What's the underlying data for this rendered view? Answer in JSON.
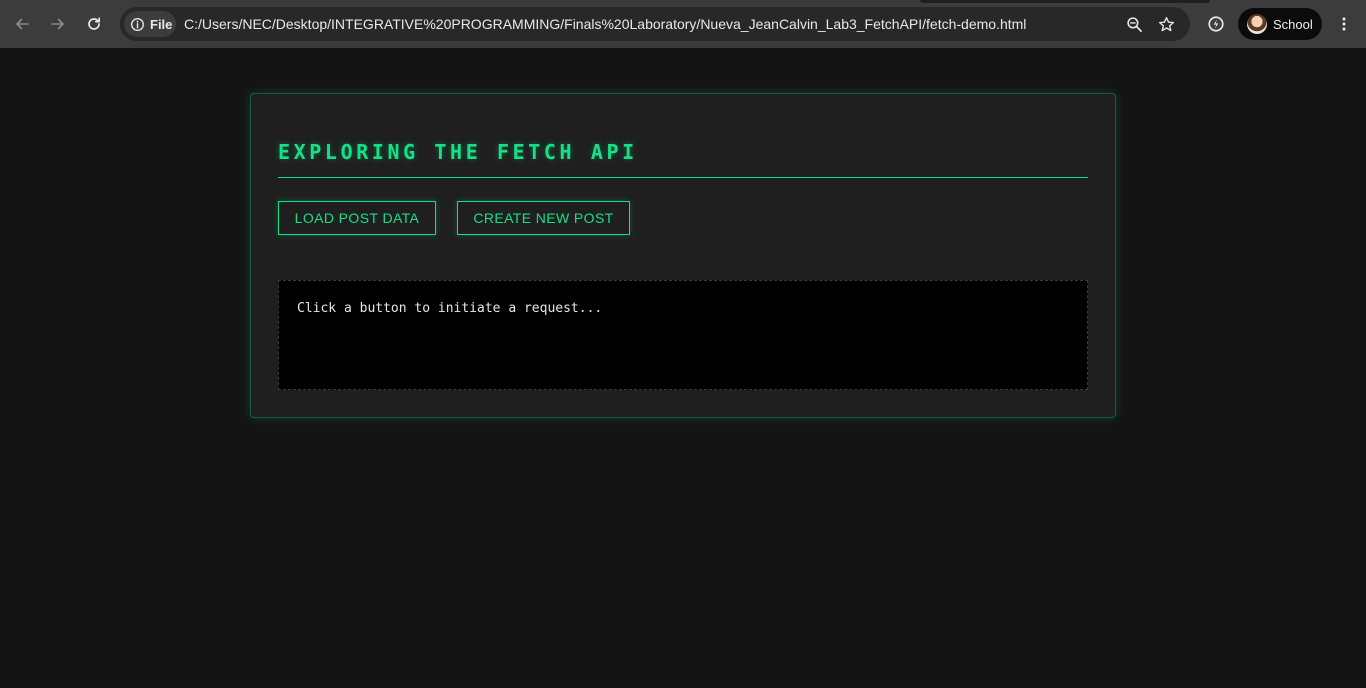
{
  "browser": {
    "file_chip_label": "File",
    "url": "C:/Users/NEC/Desktop/INTEGRATIVE%20PROGRAMMING/Finals%20Laboratory/Nueva_JeanCalvin_Lab3_FetchAPI/fetch-demo.html",
    "profile_label": "School",
    "icons": [
      "back-arrow-icon",
      "forward-arrow-icon",
      "reload-icon",
      "info-icon",
      "zoom-icon",
      "star-icon",
      "extension-icon",
      "avatar",
      "kebab-menu-icon"
    ]
  },
  "page": {
    "title": "EXPLORING THE FETCH API",
    "buttons": {
      "load": "LOAD POST DATA",
      "create": "CREATE NEW POST"
    },
    "output_text": "Click a button to initiate a request..."
  },
  "colors": {
    "accent": "#16e087",
    "page_bg": "#141414",
    "card_bg": "#1f1f1f",
    "output_bg": "#000000",
    "chrome_bg": "#3c3c3c"
  }
}
